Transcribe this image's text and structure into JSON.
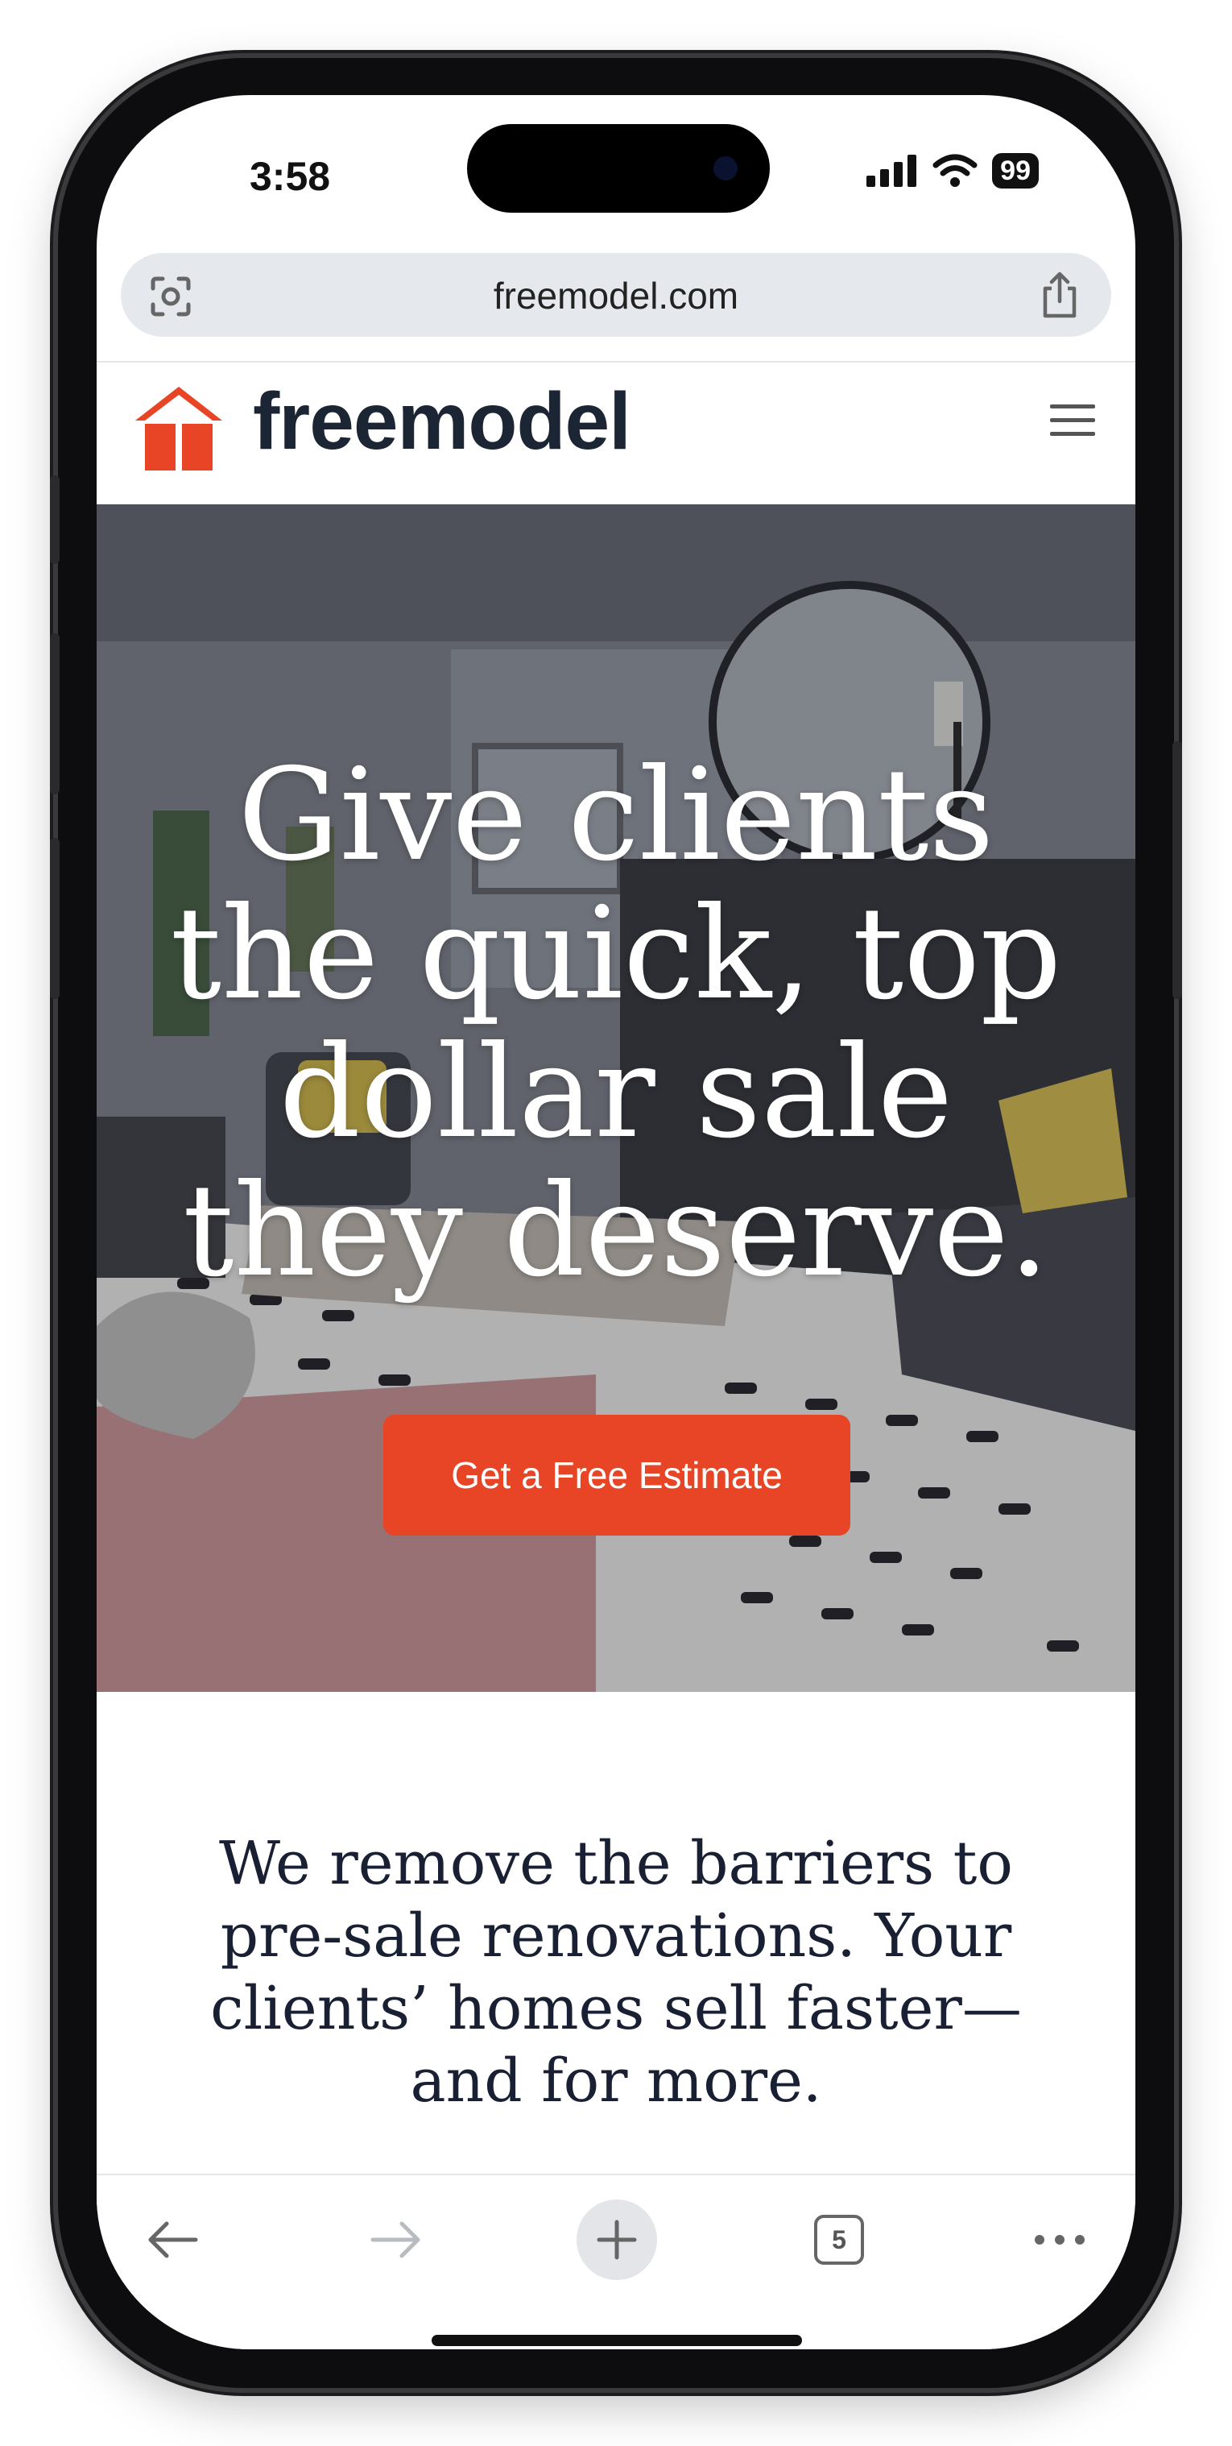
{
  "status_bar": {
    "time": "3:58",
    "battery": "99"
  },
  "browser": {
    "url": "freemodel.com",
    "tab_count": "5"
  },
  "site": {
    "logo_text": "freemodel",
    "brand_color": "#e84526"
  },
  "hero": {
    "title": "Give clients the quick, top dollar sale they deserve.",
    "cta_label": "Get a Free Estimate"
  },
  "tagline": "We remove the barriers to pre-sale renovations. Your clients’ homes sell faster—and for more.",
  "icons": {
    "url_left": "visual-search-icon",
    "share": "share-icon",
    "menu": "hamburger-menu-icon",
    "back": "back-arrow-icon",
    "forward": "forward-arrow-icon",
    "new_tab": "plus-icon",
    "tabs": "tabs-icon",
    "more": "more-dots-icon"
  }
}
